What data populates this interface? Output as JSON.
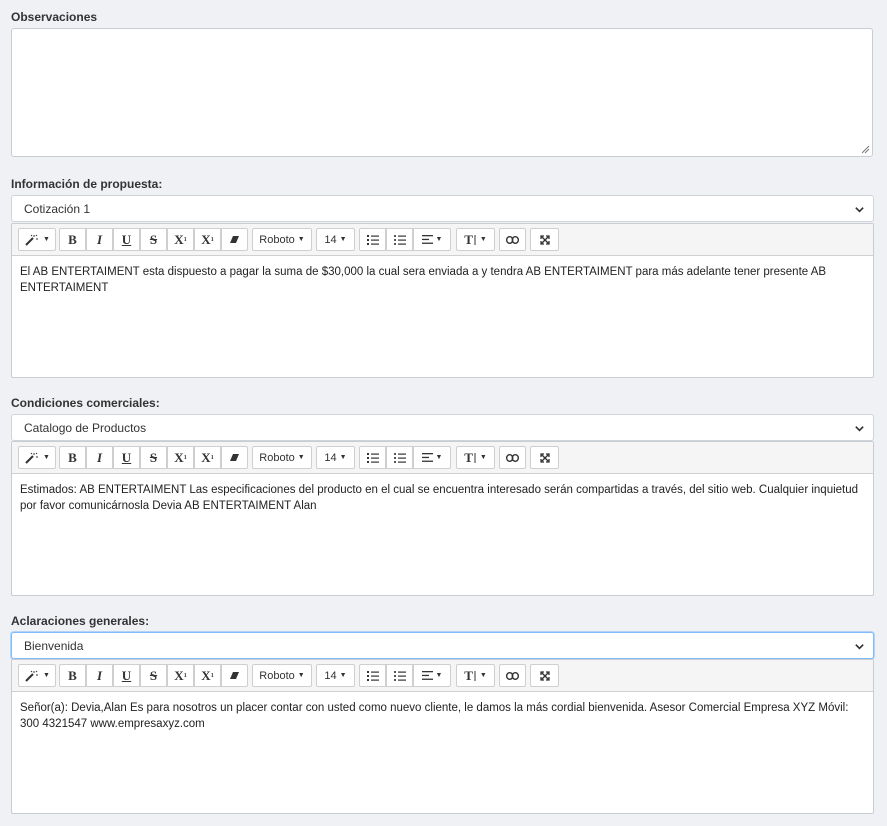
{
  "observaciones": {
    "label": "Observaciones",
    "value": ""
  },
  "sections": [
    {
      "label": "Información de propuesta:",
      "selected": "Cotización 1",
      "content": "El AB ENTERTAIMENT esta dispuesto a pagar la suma de $30,000 la cual sera enviada a y tendra AB ENTERTAIMENT para más adelante tener presente AB ENTERTAIMENT"
    },
    {
      "label": "Condiciones comerciales:",
      "selected": "Catalogo de Productos",
      "content": "Estimados: AB ENTERTAIMENT Las especificaciones del producto en el cual se encuentra interesado serán compartidas a través, del sitio web. Cualquier inquietud por favor comunicárnosla Devia AB ENTERTAIMENT Alan"
    },
    {
      "label": "Aclaraciones generales:",
      "selected": "Bienvenida",
      "content": "Señor(a): Devia,Alan Es para nosotros un placer contar con usted como nuevo cliente, le damos la más cordial bienvenida. Asesor Comercial Empresa XYZ Móvil: 300 4321547 www.empresaxyz.com"
    }
  ],
  "toolbar": {
    "bold": "B",
    "italic": "I",
    "underline": "U",
    "strike": "S",
    "superscript": "X",
    "subscript": "X",
    "font_name": "Roboto",
    "font_size": "14",
    "text_height": "T"
  }
}
